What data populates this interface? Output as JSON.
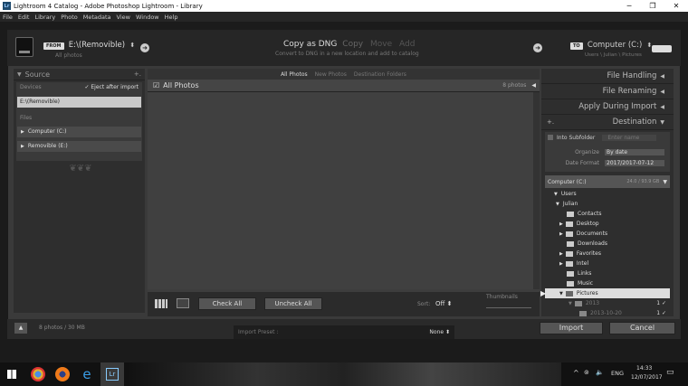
{
  "window": {
    "title": "Lightroom 4 Catalog - Adobe Photoshop Lightroom - Library",
    "logo_text": "Lr",
    "controls": [
      "─",
      "❐",
      "✕"
    ]
  },
  "menu": [
    "File",
    "Edit",
    "Library",
    "Photo",
    "Metadata",
    "View",
    "Window",
    "Help"
  ],
  "top": {
    "from_chip": "FROM",
    "from_path": "E:\\(Removible)",
    "from_arrow": "⬍",
    "from_sub": "All photos",
    "modes": [
      "Copy as DNG",
      "Copy",
      "Move",
      "Add"
    ],
    "mode_desc": "Convert to DNG in a new location and add to catalog",
    "to_chip": "TO",
    "to_path": "Computer (C:)",
    "to_arrow": "⬍",
    "to_sub": "Users \\ Julian \\ Pictures"
  },
  "source": {
    "title": "Source",
    "plus": "+.",
    "devices_label": "Devices",
    "eject_label": "Eject after import",
    "device_selected": "E:\\(Removible)",
    "files_label": "Files",
    "file_items": [
      "Computer (C:)",
      "Removible (E:)"
    ]
  },
  "center": {
    "tabs": [
      "All Photos",
      "New Photos",
      "Destination Folders"
    ],
    "header_label": "All Photos",
    "photo_count": "8 photos",
    "check_all": "Check All",
    "uncheck_all": "Uncheck All",
    "sort_label": "Sort:",
    "sort_value": "Off",
    "thumbnails_label": "Thumbnails"
  },
  "right": {
    "sections": [
      "File Handling",
      "File Renaming",
      "Apply During Import"
    ],
    "destination_title": "Destination",
    "dest_plus": "+.",
    "into_subfolder": "Into Subfolder",
    "subfolder_placeholder": "Enter name",
    "organize_label": "Organize",
    "organize_value": "By date",
    "date_format_label": "Date Format",
    "date_format_value": "2017/2017-07-12",
    "volume_name": "Computer (C:)",
    "volume_space": "24.0 / 93.9 GB",
    "tree_users": "Users",
    "tree_julian": "Julian",
    "folders": [
      "Contacts",
      "Desktop",
      "Documents",
      "Downloads",
      "Favorites",
      "Intel",
      "Links",
      "Music"
    ],
    "pictures": "Pictures",
    "year_folder": "2013",
    "year_count": "1",
    "date_folder": "2013-10-20",
    "date_count": "1"
  },
  "bottom": {
    "count": "8 photos / 30 MB",
    "preset_label": "Import Preset :",
    "preset_value": "None",
    "import_btn": "Import",
    "cancel_btn": "Cancel"
  },
  "taskbar": {
    "lang": "ENG",
    "time": "14:33",
    "date": "12/07/2017"
  },
  "colors": {
    "accent_blue": "#1e4a6e",
    "panel": "#2e2e2e",
    "grid": "#3d3d3d"
  }
}
